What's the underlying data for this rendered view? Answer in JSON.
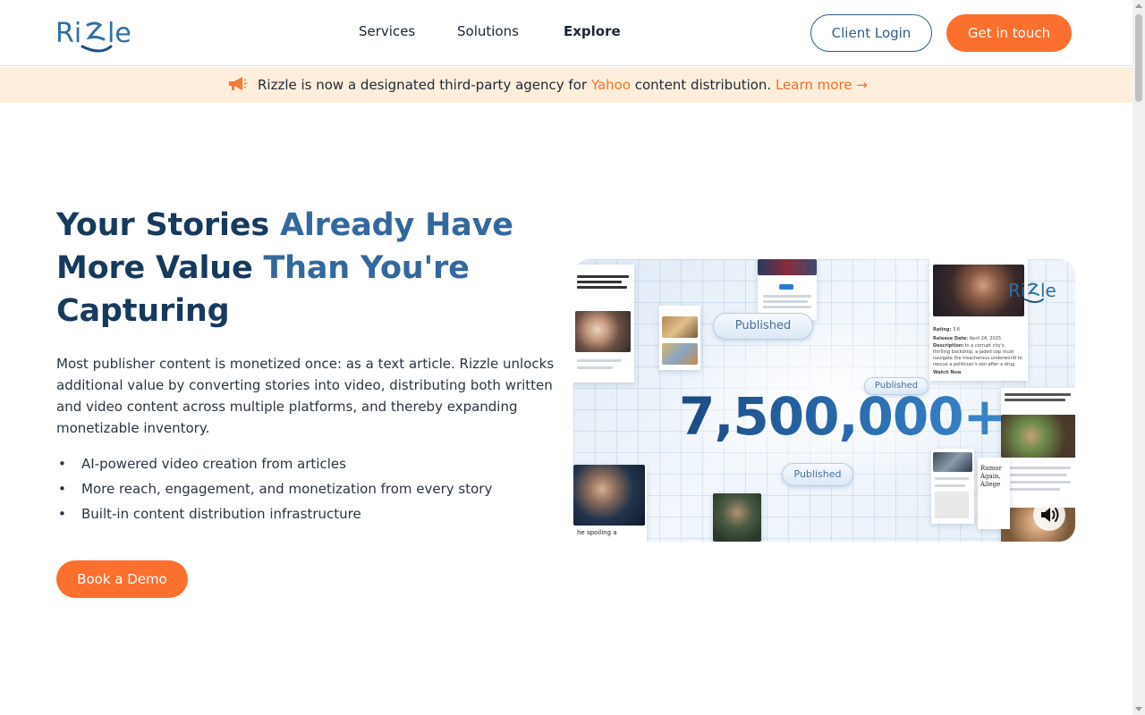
{
  "header": {
    "logo_text": "Rizzle",
    "nav": {
      "services": "Services",
      "solutions": "Solutions",
      "explore": "Explore"
    },
    "client_login": "Client Login",
    "get_in_touch": "Get in touch"
  },
  "banner": {
    "text_before": "Rizzle is now a designated third-party agency for ",
    "highlight": "Yahoo",
    "text_after": " content distribution. ",
    "link": "Learn more →"
  },
  "hero": {
    "title_line1_dark": "Your Stories ",
    "title_line1_light": "Already Have",
    "title_line2_dark": "More Value ",
    "title_line2_light": "Than You're",
    "title_line3_dark": "Capturing",
    "description": "Most publisher content is monetized once: as a text article. Rizzle unlocks additional value by converting stories into video, distributing both written and video content across multiple platforms, and thereby expanding monetizable inventory.",
    "bullets": [
      "AI-powered video creation from articles",
      "More reach, engagement, and monetization from every story",
      "Built-in content distribution infrastructure"
    ],
    "cta": "Book a Demo"
  },
  "media": {
    "counter": "7,500,000+",
    "pill_labels": [
      "Published",
      "Published",
      "Published"
    ],
    "card_rating_label": "Rating:",
    "card_rating_value": "3.6",
    "card_release_label": "Release Date:",
    "card_release_value": "April 24, 2025",
    "card_desc_label": "Description:",
    "card_desc_text": "In a corrupt city's thrilling backdrop, a jaded cop must navigate the treacherous underworld to rescue a politician's son after a drug heist gone awry.",
    "card_watch": "Watch Now",
    "snippet_title": "Rumor Again, Allege",
    "snippet_bottom": "he spoiling a",
    "overlay_label": "Rizzle"
  },
  "colors": {
    "accent_orange": "#fb6f2f",
    "navy": "#163a5c",
    "blue": "#33689e",
    "banner_bg": "#fdeedb"
  }
}
